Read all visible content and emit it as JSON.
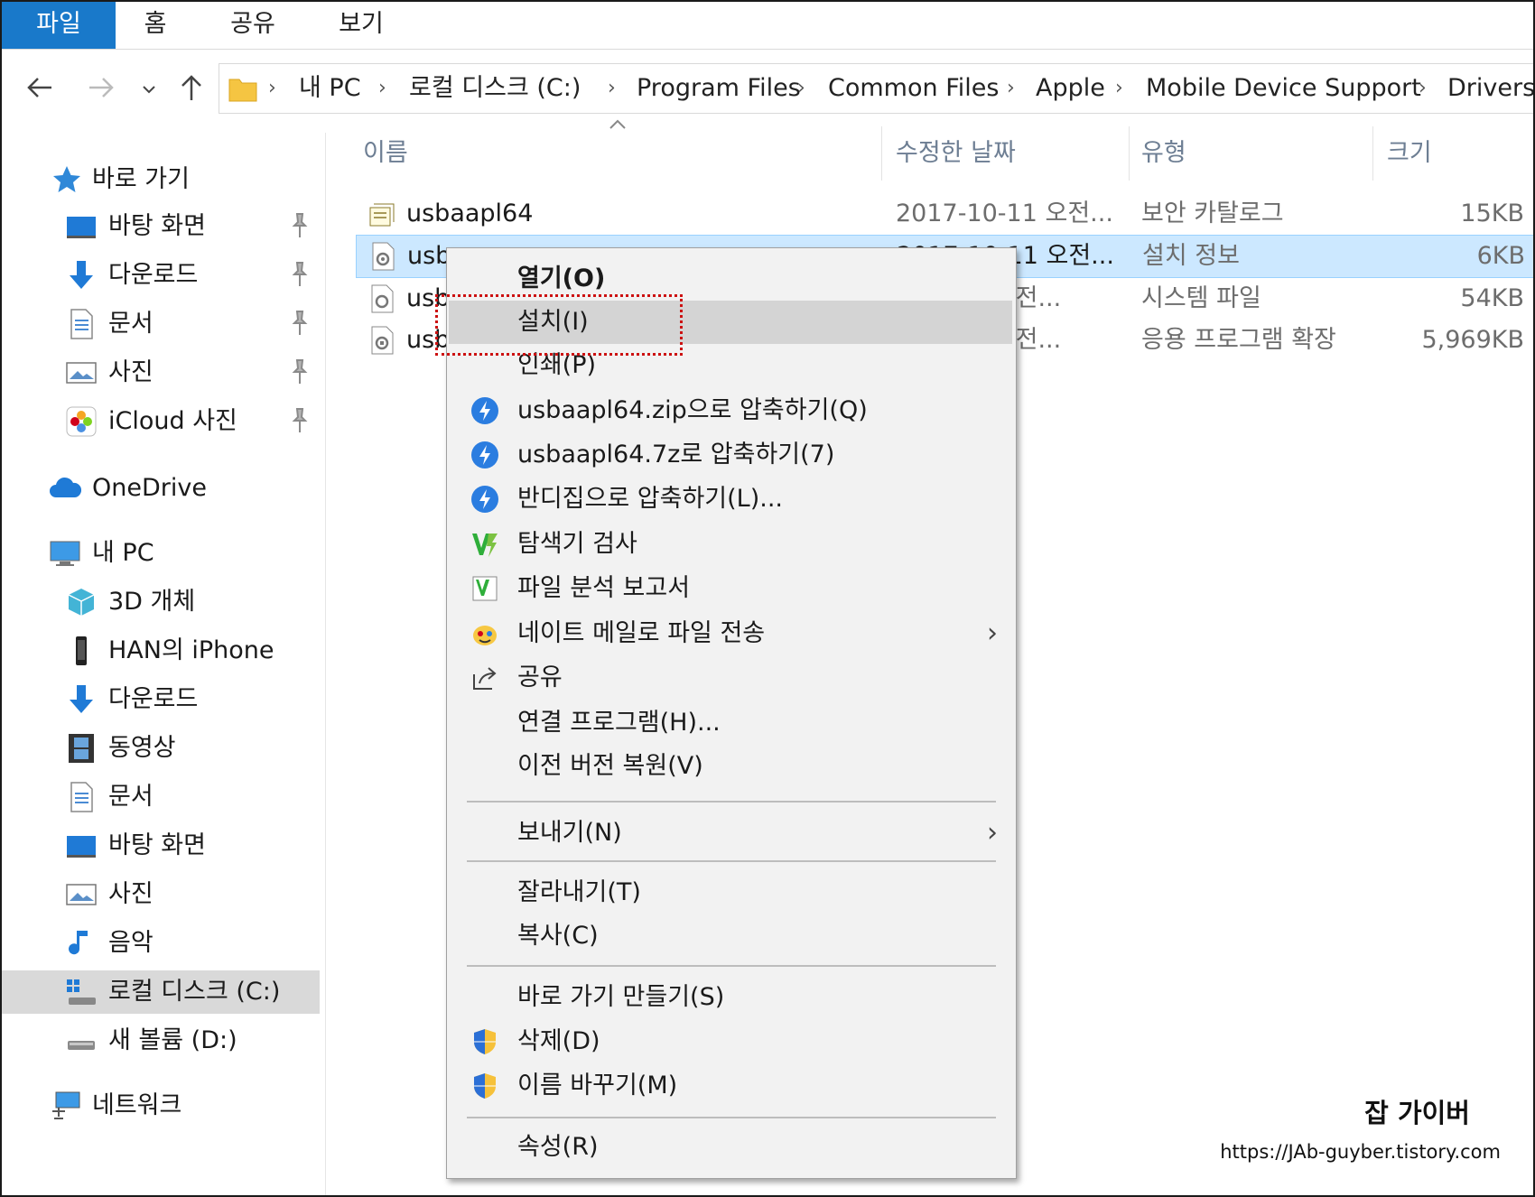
{
  "ribbon": {
    "tabs": [
      "파일",
      "홈",
      "공유",
      "보기"
    ],
    "active_index": 0
  },
  "address": {
    "crumbs": [
      "내 PC",
      "로컬 디스크 (C:)",
      "Program Files",
      "Common Files",
      "Apple",
      "Mobile Device Support",
      "Drivers"
    ]
  },
  "nav": {
    "quick_access": "바로 가기",
    "quick_items": [
      "바탕 화면",
      "다운로드",
      "문서",
      "사진",
      "iCloud 사진"
    ],
    "onedrive": "OneDrive",
    "this_pc": "내 PC",
    "pc_items": [
      "3D 개체",
      "HAN의 iPhone",
      "다운로드",
      "동영상",
      "문서",
      "바탕 화면",
      "사진",
      "음악",
      "로컬 디스크 (C:)",
      "새 볼륨 (D:)"
    ],
    "network": "네트워크"
  },
  "columns": {
    "name": "이름",
    "date": "수정한 날짜",
    "type": "유형",
    "size": "크기"
  },
  "files": [
    {
      "name": "usbaapl64",
      "date": "2017-10-11 오전...",
      "type": "보안 카탈로그",
      "size": "15KB",
      "icon": "security-catalog-icon"
    },
    {
      "name": "usbaapl64",
      "date": "2017-10-11 오전...",
      "type": "설치 정보",
      "size": "6KB",
      "icon": "setup-info-icon"
    },
    {
      "name": "usbaapl64",
      "date": "2017-10-11 오전...",
      "type": "시스템 파일",
      "size": "54KB",
      "icon": "system-file-icon"
    },
    {
      "name": "usbaapl64",
      "date": "2017-10-11 오전...",
      "type": "응용 프로그램 확장",
      "size": "5,969KB",
      "icon": "dll-icon"
    }
  ],
  "visible_name_fragments": [
    "usb",
    "usb",
    "usb"
  ],
  "visible_date_fragments": [
    "1 오전...",
    "1 오전...",
    "1 오전..."
  ],
  "context_menu": {
    "open": "열기(O)",
    "install": "설치(I)",
    "print": "인쇄(P)",
    "zip": "usbaapl64.zip으로 압축하기(Q)",
    "sevenz": "usbaapl64.7z로 압축하기(7)",
    "bandizip": "반디집으로 압축하기(L)...",
    "scan": "탐색기 검사",
    "report": "파일 분석 보고서",
    "nate": "네이트 메일로 파일 전송",
    "share": "공유",
    "openwith": "연결 프로그램(H)...",
    "restore": "이전 버전 복원(V)",
    "sendto": "보내기(N)",
    "cut": "잘라내기(T)",
    "copy": "복사(C)",
    "shortcut": "바로 가기 만들기(S)",
    "delete": "삭제(D)",
    "rename": "이름 바꾸기(M)",
    "properties": "속성(R)"
  },
  "watermark": {
    "title": "잡 가이버",
    "url": "https://JAb-guyber.tistory.com"
  },
  "colors": {
    "ribbon_active": "#1979ca",
    "selection": "#cce8ff",
    "highlight_box": "#cc1111",
    "menu_bg": "#f2f2f2"
  }
}
